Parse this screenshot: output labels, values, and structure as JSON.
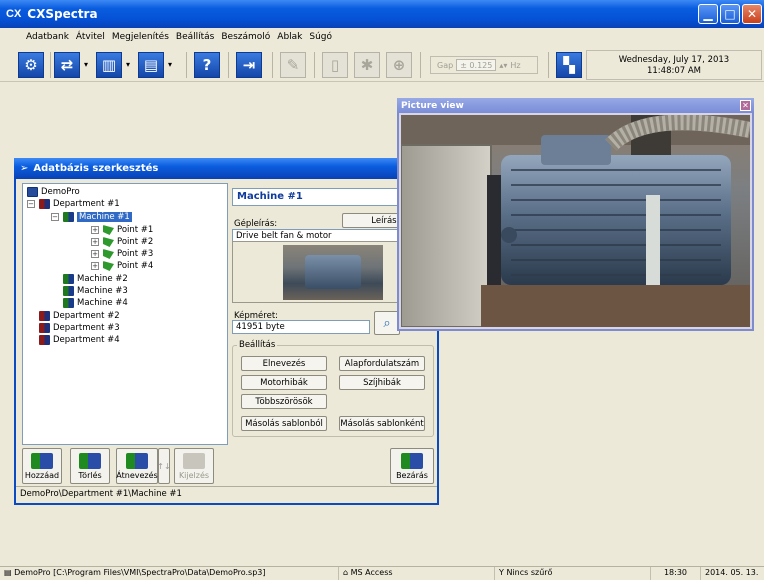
{
  "app": {
    "title": "CXSpectra",
    "logo_text": "CX"
  },
  "menu": [
    "Adatbank",
    "Átvitel",
    "Megjelenítés",
    "Beállítás",
    "Beszámoló",
    "Ablak",
    "Súgó"
  ],
  "toolbar": {
    "gap_label": "Gap",
    "gap_value": "± 0.125",
    "gap_unit": "Hz",
    "date": "Wednesday, July 17, 2013",
    "time": "11:48:07 AM"
  },
  "db_window": {
    "title": "Adatbázis szerkesztés",
    "tree": {
      "root": "DemoPro",
      "departments": [
        "Department #1",
        "Department #2",
        "Department #3",
        "Department #4"
      ],
      "machines": [
        "Machine #1",
        "Machine #2",
        "Machine #3",
        "Machine #4"
      ],
      "points": [
        "Point #1",
        "Point #2",
        "Point #3",
        "Point #4"
      ]
    },
    "detail": {
      "machine_name": "Machine #1",
      "description_label": "Gépleírás:",
      "description_button": "Leírás...",
      "description_value": "Drive belt fan & motor",
      "image_size_label": "Képméret:",
      "image_size_value": "41951 byte"
    },
    "settings": {
      "title": "Beállítás",
      "buttons": [
        "Elnevezés",
        "Alapfordulatszám",
        "Motorhibák",
        "Szíjhibák",
        "Többszörösök",
        "Másolás sablonból",
        "Másolás sablonként"
      ]
    },
    "bottom_buttons": {
      "add": "Hozzáad",
      "delete": "Törlés",
      "rename": "Átnevezés",
      "mark": "Kijelzés",
      "close": "Bezárás"
    },
    "status_path": "DemoPro\\Department #1\\Machine #1"
  },
  "picture_window": {
    "title": "Picture view"
  },
  "statusbar": {
    "db_path": "DemoPro [C:\\Program Files\\VMI\\SpectraPro\\Data\\DemoPro.sp3]",
    "db_engine": "MS Access",
    "filter": "Nincs szűrő",
    "clock": "18:30",
    "date": "2014. 05. 13."
  }
}
